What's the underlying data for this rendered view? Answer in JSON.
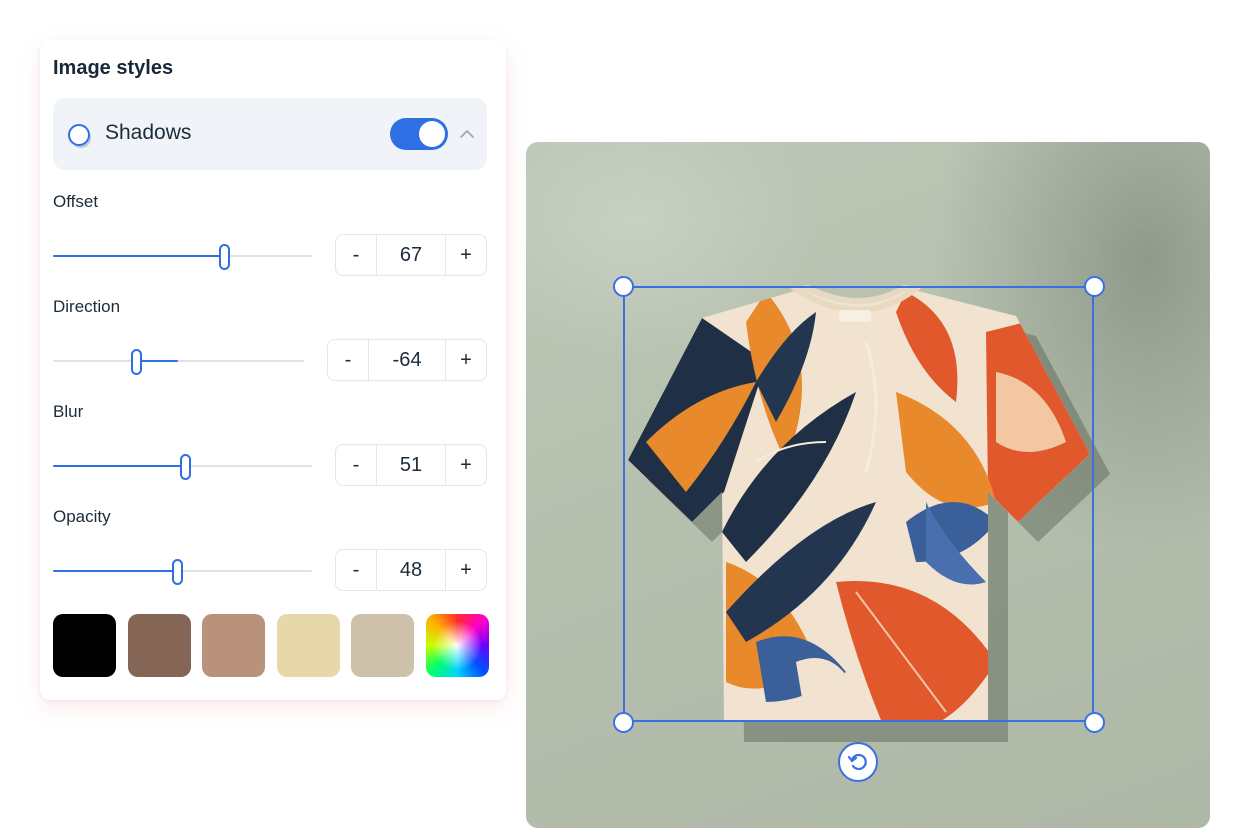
{
  "panel": {
    "title": "Image styles",
    "shadow": {
      "label": "Shadows",
      "enabled": true
    }
  },
  "controls": {
    "offset": {
      "label": "Offset",
      "value": "67",
      "slider_fraction": 0.66
    },
    "direction": {
      "label": "Direction",
      "value": "-64",
      "slider_fraction": 0.33,
      "slider_fill_start": 0.33,
      "slider_fill_end": 0.5
    },
    "blur": {
      "label": "Blur",
      "value": "51",
      "slider_fraction": 0.51
    },
    "opacity": {
      "label": "Opacity",
      "value": "48",
      "slider_fraction": 0.48
    }
  },
  "stepper": {
    "minus_label": "-",
    "plus_label": "+"
  },
  "swatches": [
    {
      "name": "black",
      "color": "#000000"
    },
    {
      "name": "brown",
      "color": "#856656"
    },
    {
      "name": "tan",
      "color": "#b8927a"
    },
    {
      "name": "cream",
      "color": "#e6d8a9"
    },
    {
      "name": "beige",
      "color": "#cdc2a9"
    },
    {
      "name": "custom-color",
      "color": "rainbow"
    }
  ],
  "colors": {
    "accent": "#2f6fe4",
    "canvas_background": "#b9c3b1"
  }
}
